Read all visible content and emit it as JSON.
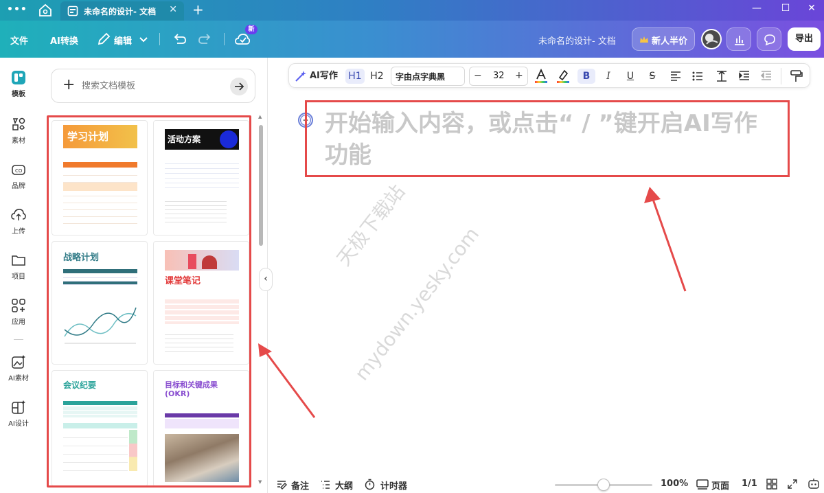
{
  "titlebar": {
    "tab_title": "未命名的设计- 文档",
    "close_glyph": "✕",
    "add_glyph": "+",
    "min_glyph": "—",
    "max_glyph": "☐",
    "win_close_glyph": "✕"
  },
  "toolbar": {
    "file_label": "文件",
    "ai_convert_label": "AI转换",
    "edit_label": "编辑",
    "new_badge": "新",
    "doc_title": "未命名的设计- 文档",
    "promo_label": "新人半价",
    "export_label": "导出"
  },
  "rail": {
    "items": [
      {
        "label": "模板",
        "icon": "template-icon"
      },
      {
        "label": "素材",
        "icon": "elements-icon"
      },
      {
        "label": "品牌",
        "icon": "brand-icon"
      },
      {
        "label": "上传",
        "icon": "upload-icon"
      },
      {
        "label": "项目",
        "icon": "folder-icon"
      },
      {
        "label": "应用",
        "icon": "apps-icon"
      },
      {
        "label": "AI素材",
        "icon": "ai-image-icon"
      },
      {
        "label": "AI设计",
        "icon": "ai-design-icon"
      }
    ]
  },
  "panel": {
    "search_placeholder": "搜索文档模板",
    "templates": [
      {
        "title": "学习计划",
        "accent": "#f07a2c"
      },
      {
        "title": "活动方案",
        "accent": "#1a2ad8"
      },
      {
        "title": "战略计划",
        "accent": "#2f7a86"
      },
      {
        "title": "课堂笔记",
        "accent": "#e23a3a"
      },
      {
        "title": "会议纪要",
        "accent": "#2aa39a"
      },
      {
        "title": "目标和关键成果",
        "subtitle": "(OKR)",
        "accent": "#8a4fd0"
      }
    ]
  },
  "format_bar": {
    "ai_write_label": "AI写作",
    "h1_label": "H1",
    "h2_label": "H2",
    "font_name": "字由点字典黑",
    "minus": "−",
    "font_size": "32",
    "plus": "+",
    "bold": "B",
    "italic": "I",
    "underline": "U",
    "strike": "S"
  },
  "editor": {
    "placeholder": "开始输入内容，或点击“ / ”键开启AI写作功能"
  },
  "watermark": {
    "line1": "天极下载站",
    "line2": "mydown.yesky.com"
  },
  "status": {
    "notes_label": "备注",
    "outline_label": "大纲",
    "timer_label": "计时器",
    "zoom_level": "100%",
    "zoom_fraction": 0.5,
    "page_label": "页面",
    "page_indicator": "1/1"
  },
  "colors": {
    "accent_red": "#e54a4a",
    "brand_purple": "#6a3df0"
  }
}
